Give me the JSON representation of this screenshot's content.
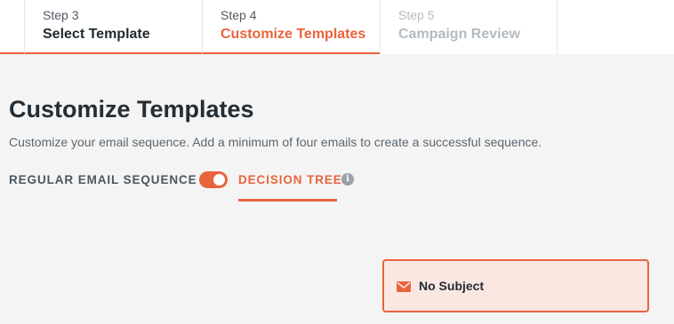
{
  "steps": [
    {
      "number": "Step 3",
      "title": "Select Template",
      "state": "completed"
    },
    {
      "number": "Step 4",
      "title": "Customize Templates",
      "state": "active"
    },
    {
      "number": "Step 5",
      "title": "Campaign Review",
      "state": "upcoming"
    }
  ],
  "page": {
    "title": "Customize Templates",
    "description": "Customize your email sequence. Add a minimum of four emails to create a successful sequence."
  },
  "mode_switch": {
    "left_label": "REGULAR EMAIL SEQUENCE",
    "right_label": "DECISION TREE",
    "selected": "DECISION TREE",
    "info_icon_glyph": "i"
  },
  "email_card": {
    "subject": "No Subject",
    "icon": "envelope-icon"
  },
  "colors": {
    "accent": "#e8643c",
    "background": "#f4f4f4",
    "card_bg": "#fbe7e1",
    "text_dark": "#232d35",
    "text_muted": "#5b6670",
    "disabled": "#b4bbc1"
  }
}
